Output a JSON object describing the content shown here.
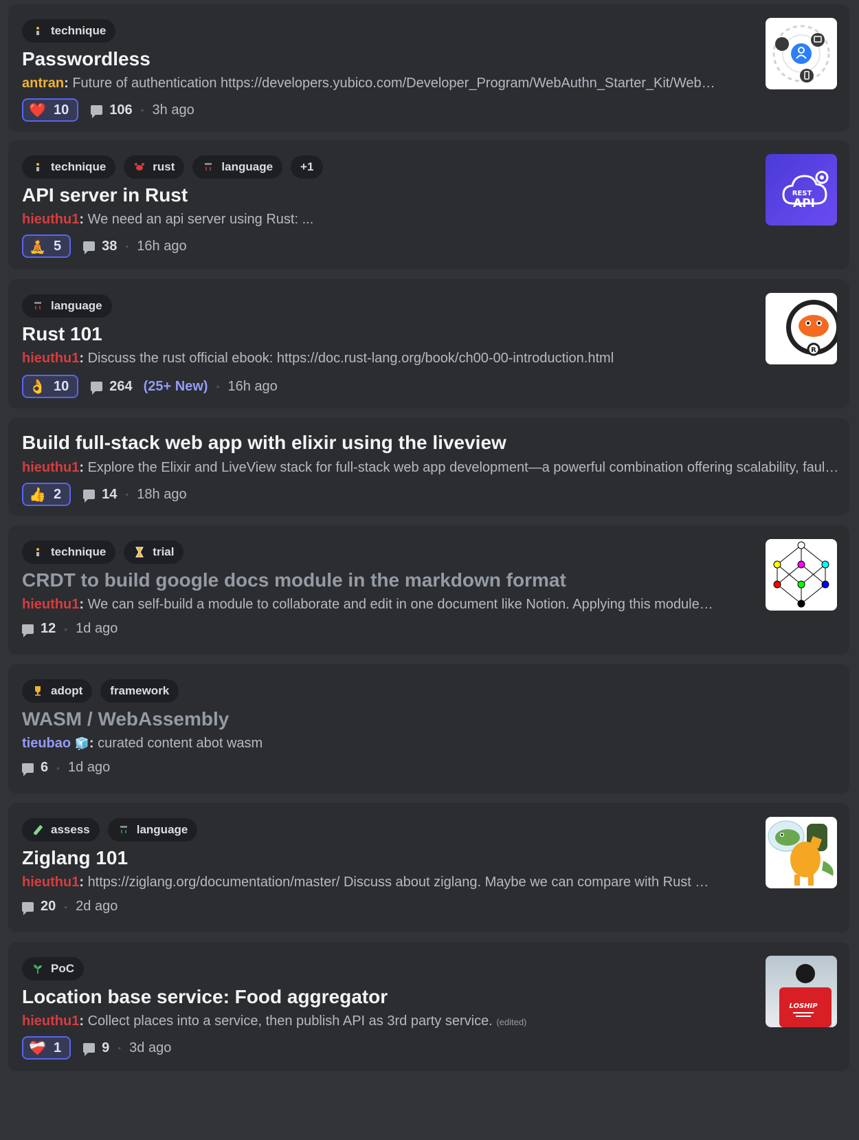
{
  "posts": [
    {
      "tags": [
        {
          "label": "technique",
          "icon": "technique-icon"
        }
      ],
      "title": "Passwordless",
      "author": "antran",
      "author_color": "#f0b232",
      "preview": "Future of authentication https://developers.yubico.com/Developer_Program/WebAuthn_Starter_Kit/WebAuthn_Starter_Kit_Guide.html",
      "reaction": {
        "emoji": "❤️",
        "count": "10"
      },
      "comments": "106",
      "time": "3h ago",
      "thumbnail": "passwordless-image"
    },
    {
      "tags": [
        {
          "label": "technique",
          "icon": "technique-icon"
        },
        {
          "label": "rust",
          "icon": "crab-icon"
        },
        {
          "label": "language",
          "icon": "language-icon"
        },
        {
          "label": "+1"
        }
      ],
      "title": "API server in Rust",
      "author": "hieuthu1",
      "author_color": "#d83c3e",
      "preview": "We need an api server using Rust: ...",
      "reaction": {
        "emoji": "🧘",
        "count": "5"
      },
      "comments": "38",
      "time": "16h ago",
      "thumbnail": "rest-api-image"
    },
    {
      "tags": [
        {
          "label": "language",
          "icon": "language-icon"
        }
      ],
      "title": "Rust 101",
      "author": "hieuthu1",
      "author_color": "#d83c3e",
      "preview": "Discuss the rust official ebook: https://doc.rust-lang.org/book/ch00-00-introduction.html",
      "reaction": {
        "emoji": "👌",
        "count": "10"
      },
      "comments": "264",
      "new_count": "(25+ New)",
      "time": "16h ago",
      "thumbnail": "ferris-crab-image"
    },
    {
      "tags": [],
      "title": "Build full-stack web app with elixir using the liveview",
      "author": "hieuthu1",
      "author_color": "#d83c3e",
      "preview": "Explore the Elixir and LiveView stack for full-stack web app development—a powerful combination offering scalability, fault tolerance and real-time interactivity.",
      "reaction": {
        "emoji": "👍",
        "count": "2"
      },
      "comments": "14",
      "time": "18h ago"
    },
    {
      "tags": [
        {
          "label": "technique",
          "icon": "technique-icon"
        },
        {
          "label": "trial",
          "icon": "hourglass-icon"
        }
      ],
      "title": "CRDT to build google docs module in the markdown format",
      "title_muted": true,
      "author": "hieuthu1",
      "author_color": "#d83c3e",
      "preview": "We can self-build a module to collaborate and edit in one document like Notion. Applying this module to build a markdown editor.",
      "comments": "12",
      "time": "1d ago",
      "thumbnail": "crdt-lattice-image"
    },
    {
      "tags": [
        {
          "label": "adopt",
          "icon": "trophy-icon"
        },
        {
          "label": "framework"
        }
      ],
      "title": "WASM / WebAssembly",
      "title_muted": true,
      "author": "tieubao",
      "author_color": "#949cf7",
      "author_badge": "🧊",
      "preview": "curated content abot wasm",
      "comments": "6",
      "time": "1d ago"
    },
    {
      "tags": [
        {
          "label": "assess",
          "icon": "test-tube-icon"
        },
        {
          "label": "language",
          "icon": "language-icon"
        }
      ],
      "title": "Ziglang 101",
      "author": "hieuthu1",
      "author_color": "#d83c3e",
      "preview": "https://ziglang.org/documentation/master/ Discuss about ziglang. Maybe we can compare with Rust or Go.",
      "comments": "20",
      "time": "2d ago",
      "thumbnail": "zig-mascot-image"
    },
    {
      "tags": [
        {
          "label": "PoC",
          "icon": "seedling-icon"
        }
      ],
      "title": "Location base service: Food aggregator",
      "author": "hieuthu1",
      "author_color": "#d83c3e",
      "preview": "Collect places into a service, then publish API as 3rd party service.",
      "edited": "(edited)",
      "reaction": {
        "emoji": "❤️‍🩹",
        "count": "1"
      },
      "comments": "9",
      "time": "3d ago",
      "thumbnail": "loship-delivery-image"
    }
  ]
}
